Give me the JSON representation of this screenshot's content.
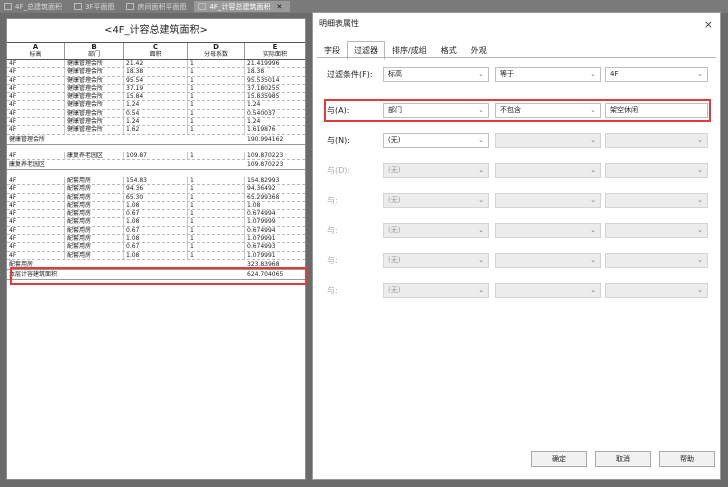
{
  "tabs": [
    {
      "label": "4F_总建筑面积"
    },
    {
      "label": "3F平面图"
    },
    {
      "label": "房间面积平面图"
    },
    {
      "label": "4F_计容总建筑面积"
    }
  ],
  "schedule": {
    "title": "<4F_计容总建筑面积>",
    "columns": [
      {
        "letter": "A",
        "name": "标高"
      },
      {
        "letter": "B",
        "name": "部门"
      },
      {
        "letter": "C",
        "name": "面积"
      },
      {
        "letter": "D",
        "name": "分母系数"
      },
      {
        "letter": "E",
        "name": "实际面积"
      }
    ],
    "group1_rows": [
      [
        "4F",
        "健康管理会所",
        "21.42",
        "1",
        "21.419996"
      ],
      [
        "4F",
        "健康管理会所",
        "18.38",
        "1",
        "18.38"
      ],
      [
        "4F",
        "健康管理会所",
        "95.54",
        "1",
        "95.535014"
      ],
      [
        "4F",
        "健康管理会所",
        "37.19",
        "1",
        "37.180255"
      ],
      [
        "4F",
        "健康管理会所",
        "15.84",
        "1",
        "15.835985"
      ],
      [
        "4F",
        "健康管理会所",
        "1.24",
        "1",
        "1.24"
      ],
      [
        "4F",
        "健康管理会所",
        "0.54",
        "1",
        "0.540037"
      ],
      [
        "4F",
        "健康管理会所",
        "1.24",
        "1",
        "1.24"
      ],
      [
        "4F",
        "健康管理会所",
        "1.62",
        "1",
        "1.619876"
      ]
    ],
    "group1_sum": {
      "label": "健康管理会所",
      "value": "190.994162"
    },
    "group2_rows": [
      [
        "4F",
        "康复养老园区",
        "109.87",
        "1",
        "109.870223"
      ]
    ],
    "group2_sum": {
      "label": "康复养老园区",
      "value": "109.870223"
    },
    "group3_rows": [
      [
        "4F",
        "配套用房",
        "154.83",
        "1",
        "154.82993"
      ],
      [
        "4F",
        "配套用房",
        "94.36",
        "1",
        "94.36492"
      ],
      [
        "4F",
        "配套用房",
        "65.30",
        "1",
        "65.299368"
      ],
      [
        "4F",
        "配套用房",
        "1.08",
        "1",
        "1.08"
      ],
      [
        "4F",
        "配套用房",
        "0.67",
        "1",
        "0.674994"
      ],
      [
        "4F",
        "配套用房",
        "1.08",
        "1",
        "1.079999"
      ],
      [
        "4F",
        "配套用房",
        "0.67",
        "1",
        "0.674994"
      ],
      [
        "4F",
        "配套用房",
        "1.08",
        "1",
        "1.079991"
      ],
      [
        "4F",
        "配套用房",
        "0.67",
        "1",
        "0.674993"
      ],
      [
        "4F",
        "配套用房",
        "1.08",
        "1",
        "1.079991"
      ]
    ],
    "group3_sum": {
      "label": "配套用房",
      "value": "323.83968"
    },
    "total": {
      "label": "本层计容建筑面积",
      "value": "624.704065"
    }
  },
  "dialog": {
    "title": "明细表属性",
    "close": "×",
    "tabs": [
      "字段",
      "过滤器",
      "排序/成组",
      "格式",
      "外观"
    ],
    "filters": [
      {
        "label": "过滤条件(F):",
        "field": "标高",
        "op": "等于",
        "value": "4F",
        "value_type": "select",
        "disabled": false
      },
      {
        "label": "与(A):",
        "field": "部门",
        "op": "不包含",
        "value": "架空休闲",
        "value_type": "text",
        "disabled": false
      },
      {
        "label": "与(N):",
        "field": "(无)",
        "op": "",
        "value": "",
        "value_type": "select",
        "disabled": false
      },
      {
        "label": "与(D):",
        "field": "(无)",
        "op": "",
        "value": "",
        "value_type": "select",
        "disabled": true
      },
      {
        "label": "与:",
        "field": "(无)",
        "op": "",
        "value": "",
        "value_type": "select",
        "disabled": true
      },
      {
        "label": "与:",
        "field": "(无)",
        "op": "",
        "value": "",
        "value_type": "select",
        "disabled": true
      },
      {
        "label": "与:",
        "field": "(无)",
        "op": "",
        "value": "",
        "value_type": "select",
        "disabled": true
      },
      {
        "label": "与:",
        "field": "(无)",
        "op": "",
        "value": "",
        "value_type": "select",
        "disabled": true
      }
    ],
    "buttons": {
      "ok": "确定",
      "cancel": "取消",
      "help": "帮助"
    }
  }
}
